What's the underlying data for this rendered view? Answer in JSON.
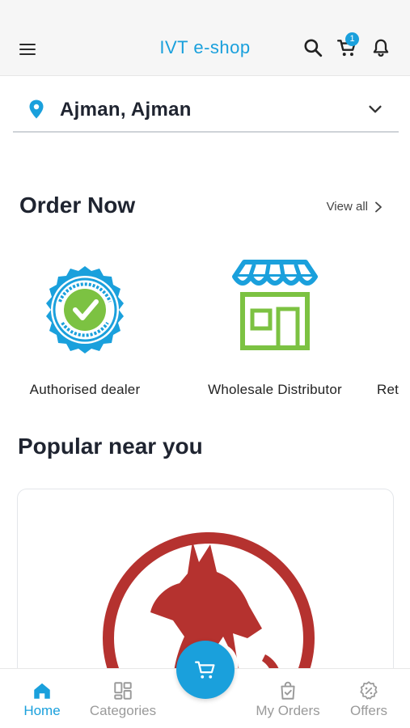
{
  "header": {
    "title": "IVT e-shop",
    "cart_count": "1",
    "icons": [
      "menu-icon",
      "search-icon",
      "cart-icon",
      "bell-icon"
    ]
  },
  "location": {
    "text": "Ajman, Ajman"
  },
  "order_now": {
    "title": "Order Now",
    "view_all": "View all",
    "categories": [
      {
        "label": "Authorised dealer",
        "icon": "authorised-dealer-badge"
      },
      {
        "label": "Wholesale Distributor",
        "icon": "storefront-icon"
      },
      {
        "label": "Ret"
      }
    ]
  },
  "popular": {
    "title": "Popular near you"
  },
  "bottom_nav": {
    "items": [
      {
        "label": "Home",
        "icon": "home-icon"
      },
      {
        "label": "Categories",
        "icon": "categories-icon"
      },
      {
        "label": "My Orders",
        "icon": "orders-icon"
      },
      {
        "label": "Offers",
        "icon": "offers-icon"
      }
    ],
    "fab_icon": "cart-icon"
  },
  "colors": {
    "accent": "#1aa0dc",
    "badge_green": "#7cc242",
    "store_red": "#b5322f"
  }
}
